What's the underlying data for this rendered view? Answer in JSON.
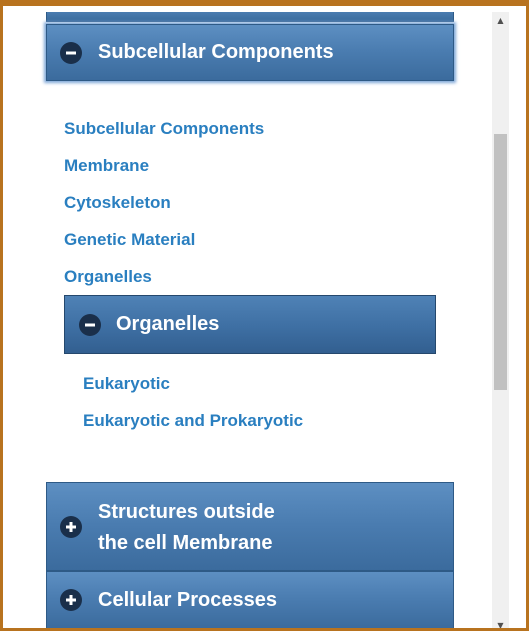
{
  "accordion": {
    "subcellular": {
      "label": "Subcellular Components",
      "state_icon": "minus-circle-icon",
      "links": [
        "Subcellular Components",
        "Membrane",
        "Cytoskeleton",
        "Genetic Material",
        "Organelles"
      ]
    },
    "organelles": {
      "label": "Organelles",
      "state_icon": "minus-circle-icon",
      "links": [
        "Eukaryotic",
        "Eukaryotic and Prokaryotic"
      ]
    },
    "structures": {
      "label_line1": "Structures outside",
      "label_line2": "the cell Membrane",
      "state_icon": "plus-circle-icon"
    },
    "cellular": {
      "label": "Cellular Processes",
      "state_icon": "plus-circle-icon"
    }
  },
  "colors": {
    "link": "#2a7fc0",
    "header_top": "#5d8fc2",
    "header_bottom": "#3b6b9d",
    "icon_bg": "#1a2f4a",
    "window_border": "#b8731f"
  }
}
